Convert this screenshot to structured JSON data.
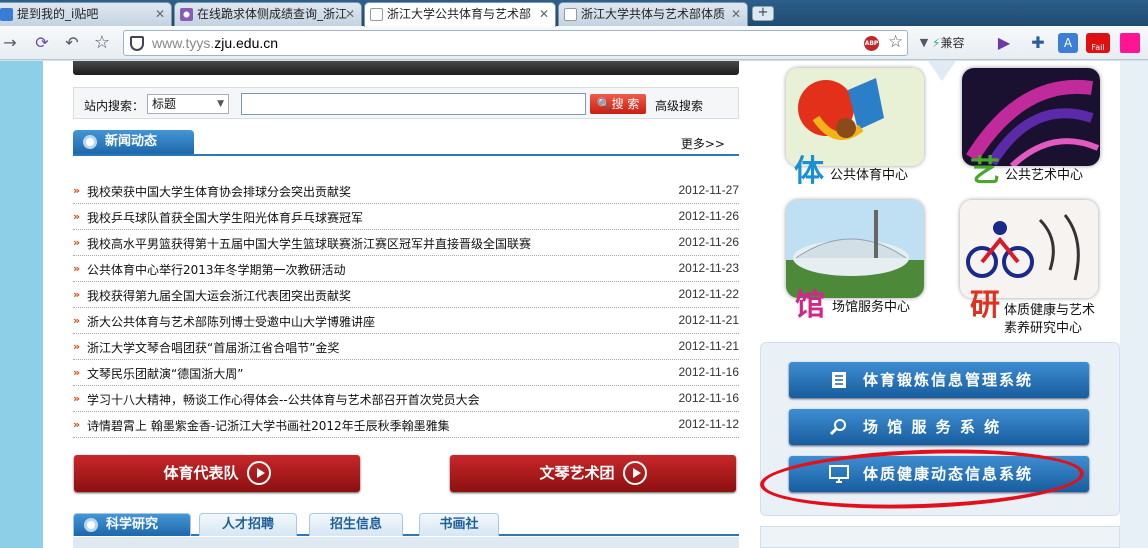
{
  "browser": {
    "tabs": [
      {
        "title": "提到我的_i贴吧"
      },
      {
        "title": "在线跪求体侧成绩查询_浙江"
      },
      {
        "title": "浙江大学公共体育与艺术部"
      },
      {
        "title": "浙江大学共体与艺术部体质"
      }
    ],
    "newtab_glyph": "+",
    "url_prefix": "www.tyys.",
    "url_host": "zju.edu.cn",
    "compat_label": "兼容",
    "abp_label": "ABP",
    "fail_label": "Fail"
  },
  "search": {
    "label": "站内搜索：",
    "select_value": "标题",
    "input_value": "",
    "button_label": "搜 索",
    "advanced_label": "高级搜索"
  },
  "news": {
    "title": "新闻动态",
    "more_label": "更多>>",
    "items": [
      {
        "title": "我校荣获中国大学生体育协会排球分会突出贡献奖",
        "date": "2012-11-27"
      },
      {
        "title": "我校乒乓球队首获全国大学生阳光体育乒乓球赛冠军",
        "date": "2012-11-26"
      },
      {
        "title": "我校高水平男篮获得第十五届中国大学生篮球联赛浙江赛区冠军并直接晋级全国联赛",
        "date": "2012-11-26"
      },
      {
        "title": "公共体育中心举行2013年冬学期第一次教研活动",
        "date": "2012-11-23"
      },
      {
        "title": "我校获得第九届全国大运会浙江代表团突出贡献奖",
        "date": "2012-11-22"
      },
      {
        "title": "浙大公共体育与艺术部陈列博士受邀中山大学博雅讲座",
        "date": "2012-11-21"
      },
      {
        "title": "浙江大学文琴合唱团获“首届浙江省合唱节”金奖",
        "date": "2012-11-21"
      },
      {
        "title": "文琴民乐团献演“德国浙大周”",
        "date": "2012-11-16"
      },
      {
        "title": "学习十八大精神，畅谈工作心得体会--公共体育与艺术部召开首次党员大会",
        "date": "2012-11-16"
      },
      {
        "title": "诗情碧霄上 翰墨紫金香-记浙江大学书画社2012年壬辰秋季翰墨雅集",
        "date": "2012-11-12"
      }
    ]
  },
  "buttons": {
    "sports_team": "体育代表队",
    "art_troupe": "文琴艺术团"
  },
  "bottom_tabs": [
    {
      "label": "科学研究"
    },
    {
      "label": "人才招聘"
    },
    {
      "label": "招生信息"
    },
    {
      "label": "书画社"
    }
  ],
  "centers": [
    {
      "char": "体",
      "label": "公共体育中心",
      "color": "#1a8fd1"
    },
    {
      "char": "艺",
      "label": "公共艺术中心",
      "color": "#49a82c"
    },
    {
      "char": "馆",
      "label": "场馆服务中心",
      "color": "#d0288a"
    },
    {
      "char": "研",
      "label_line1": "体质健康与艺术",
      "label_line2": "素养研究中心",
      "color": "#e0301e"
    }
  ],
  "systems": [
    {
      "label": "体育锻炼信息管理系统"
    },
    {
      "label": "场 馆 服 务 系 统"
    },
    {
      "label": "体质健康动态信息系统"
    }
  ]
}
